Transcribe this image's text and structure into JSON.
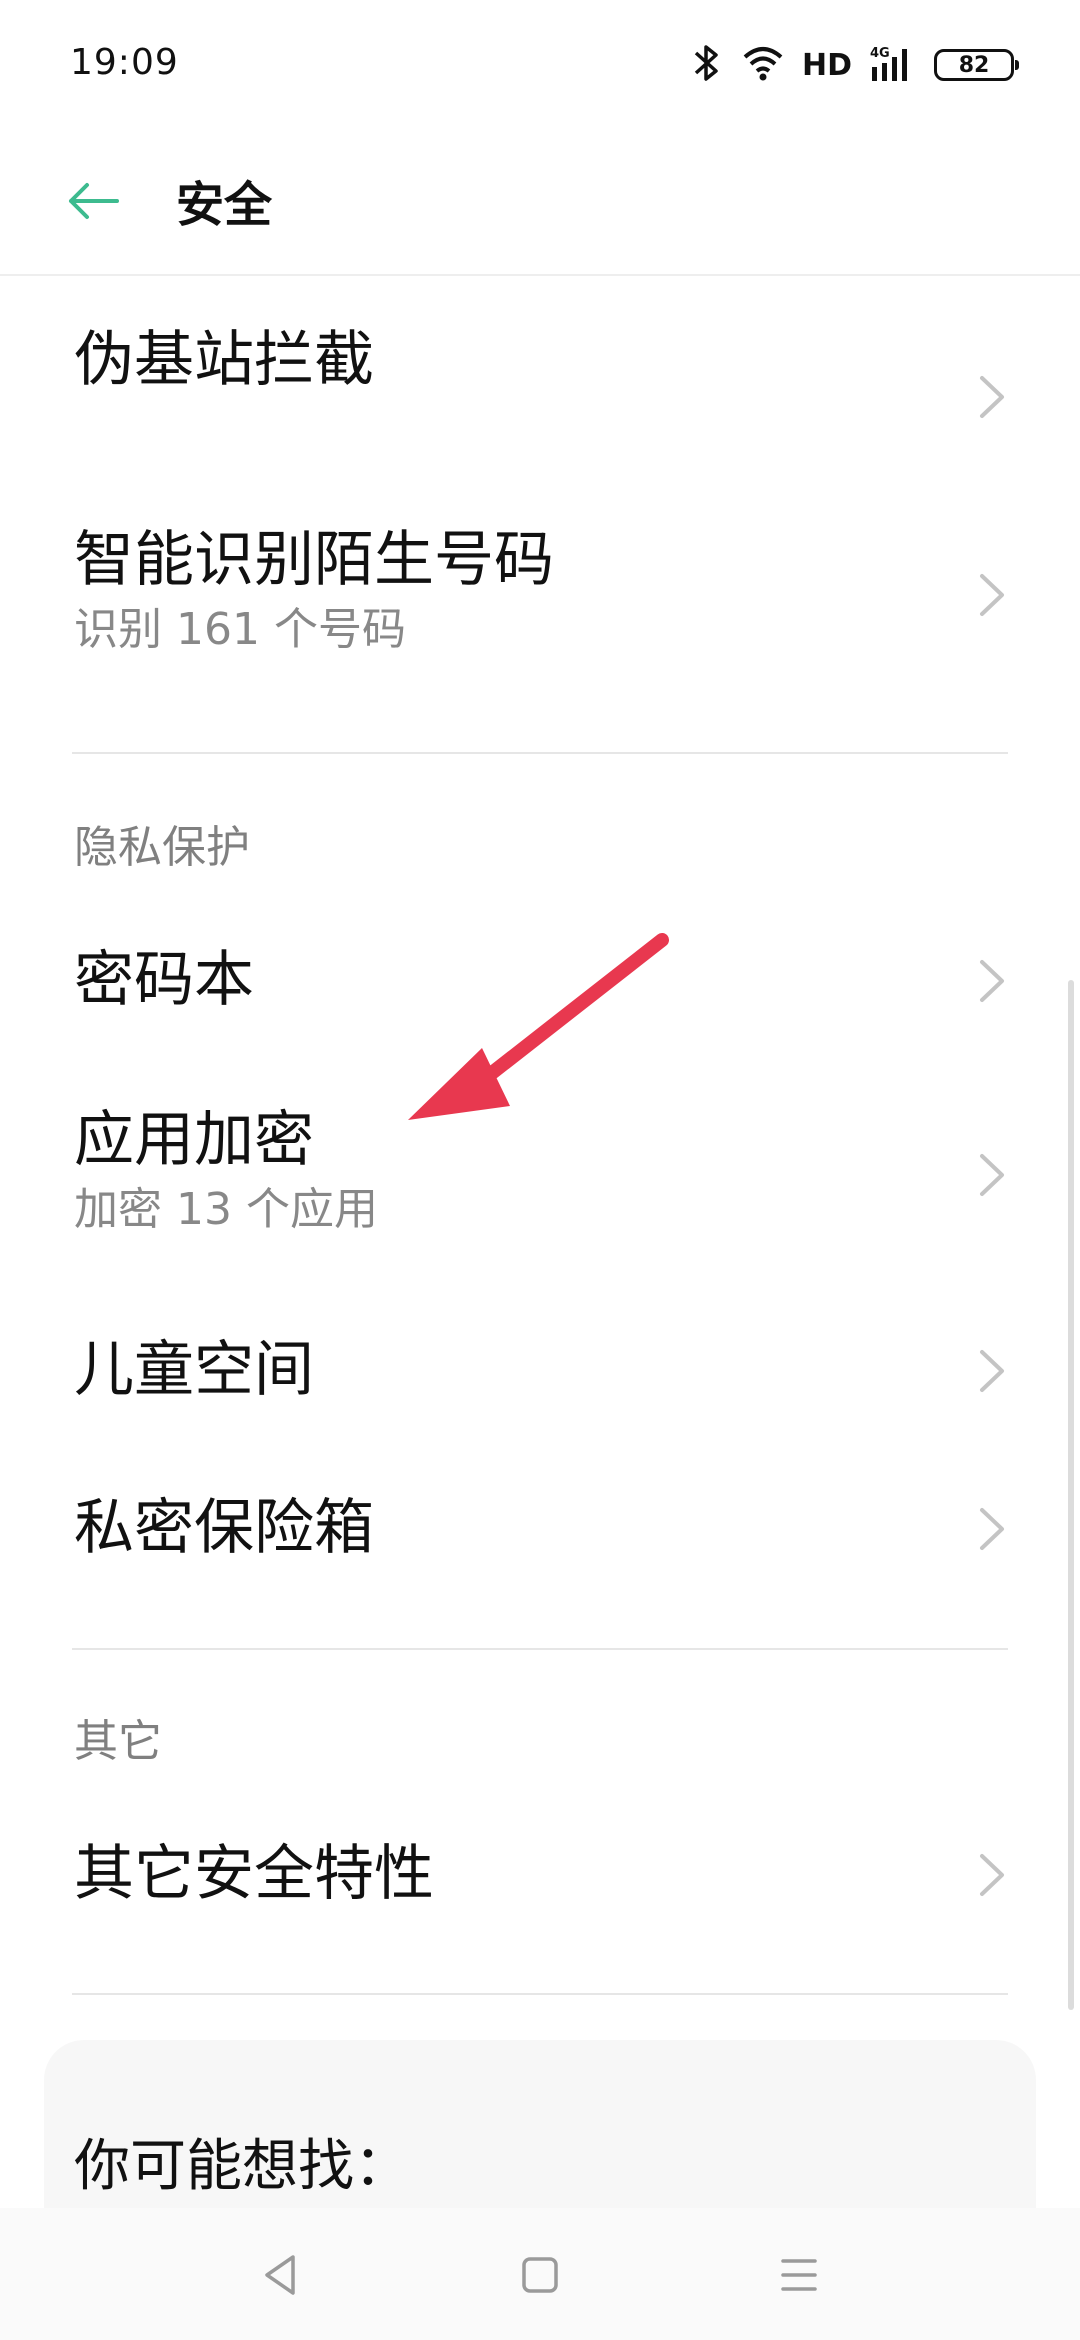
{
  "status_bar": {
    "time": "19:09",
    "network": "HD",
    "signal_label": "4G",
    "battery": "82"
  },
  "header": {
    "title": "安全"
  },
  "items": {
    "fake_base_station": {
      "title": "伪基站拦截"
    },
    "identify_numbers": {
      "title": "智能识别陌生号码",
      "subtitle": "识别 161 个号码"
    },
    "passwords": {
      "title": "密码本"
    },
    "app_lock": {
      "title": "应用加密",
      "subtitle": "加密 13 个应用"
    },
    "kids_space": {
      "title": "儿童空间"
    },
    "private_safe": {
      "title": "私密保险箱"
    },
    "other_features": {
      "title": "其它安全特性"
    }
  },
  "sections": {
    "privacy": "隐私保护",
    "other": "其它"
  },
  "suggestions": {
    "title": "你可能想找："
  },
  "colors": {
    "accent": "#3dbb8f",
    "annotation": "#e8384f"
  },
  "icons": {
    "back": "arrow-left-icon",
    "chevron": "chevron-right-icon",
    "nav_back": "triangle-back-icon",
    "nav_home": "square-home-icon",
    "nav_menu": "menu-lines-icon"
  }
}
